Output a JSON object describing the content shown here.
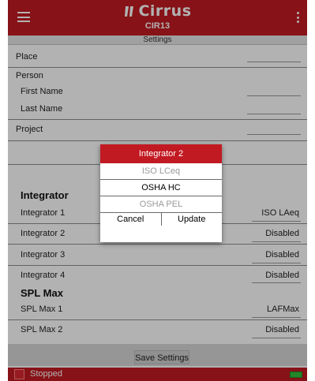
{
  "header": {
    "app_name": "Cirrus",
    "model": "CIR13",
    "menu_icon": "hamburger-menu-icon",
    "overflow_icon": "more-vert-icon"
  },
  "subheader": {
    "title": "Settings"
  },
  "fields": {
    "place": {
      "label": "Place",
      "value": ""
    },
    "person": {
      "label": "Person"
    },
    "first_name": {
      "label": "First Name",
      "value": ""
    },
    "last_name": {
      "label": "Last Name",
      "value": ""
    },
    "project": {
      "label": "Project",
      "value": ""
    }
  },
  "integrator_section": {
    "title": "Integrator",
    "rows": [
      {
        "label": "Integrator 1",
        "value": "ISO LAeq"
      },
      {
        "label": "Integrator 2",
        "value": "Disabled"
      },
      {
        "label": "Integrator 3",
        "value": "Disabled"
      },
      {
        "label": "Integrator 4",
        "value": "Disabled"
      }
    ]
  },
  "splmax_section": {
    "title": "SPL Max",
    "rows": [
      {
        "label": "SPL Max 1",
        "value": "LAFMax"
      },
      {
        "label": "SPL Max 2",
        "value": "Disabled"
      }
    ]
  },
  "footer": {
    "save_label": "Save Settings"
  },
  "status": {
    "text": "Stopped"
  },
  "dialog": {
    "title": "Integrator 2",
    "options": [
      {
        "label": "ISO LCeq",
        "selected": false
      },
      {
        "label": "OSHA HC",
        "selected": true
      },
      {
        "label": "OSHA PEL",
        "selected": false
      }
    ],
    "cancel_label": "Cancel",
    "update_label": "Update"
  },
  "colors": {
    "brand_red": "#c21a22",
    "battery_green": "#34c23b"
  }
}
